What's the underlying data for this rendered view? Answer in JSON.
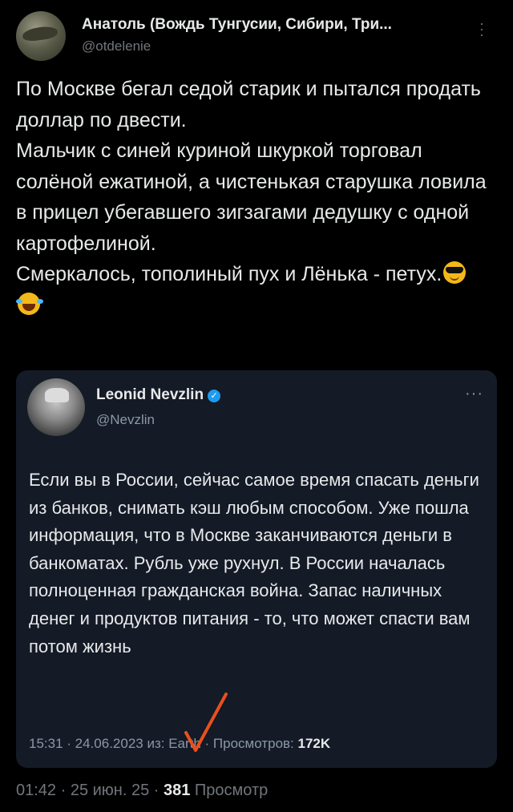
{
  "author": {
    "name": "Анатоль (Вождь Тунгусии, Сибири, Три...",
    "handle": "@otdelenie"
  },
  "tweet": {
    "text": "По Москве бегал седой старик и пытался продать доллар по двести.\nМальчик с синей куриной шкуркой торговал солёной ежатиной, а чистенькая старушка ловила в прицел убегавшего зигзагами дедушку с одной картофелиной.\nСмеркалось, тополиный пух и Лёнька - петух.",
    "emojis": [
      "smiling-face-with-sunglasses",
      "face-with-tears-of-joy"
    ]
  },
  "quoted_tweet": {
    "name": "Leonid Nevzlin",
    "handle": "@Nevzlin",
    "verified": true,
    "text": "Если вы в России, сейчас самое время спасать деньги из банков, снимать кэш любым способом. Уже пошла информация, что в Москве заканчиваются деньги в банкоматах. Рубль уже рухнул. В России началась полноценная гражданская война. Запас наличных денег и продуктов питания - то, что может спасти вам потом жизнь",
    "meta_prefix": "15:31 · 24.06.2023 из: Earth · Просмотров: ",
    "views": "172K",
    "annotation_color": "#e8501e"
  },
  "footer": {
    "meta_prefix": "01:42 · 25 июн. 25 · ",
    "views": "381",
    "views_suffix": " Просмотр"
  }
}
